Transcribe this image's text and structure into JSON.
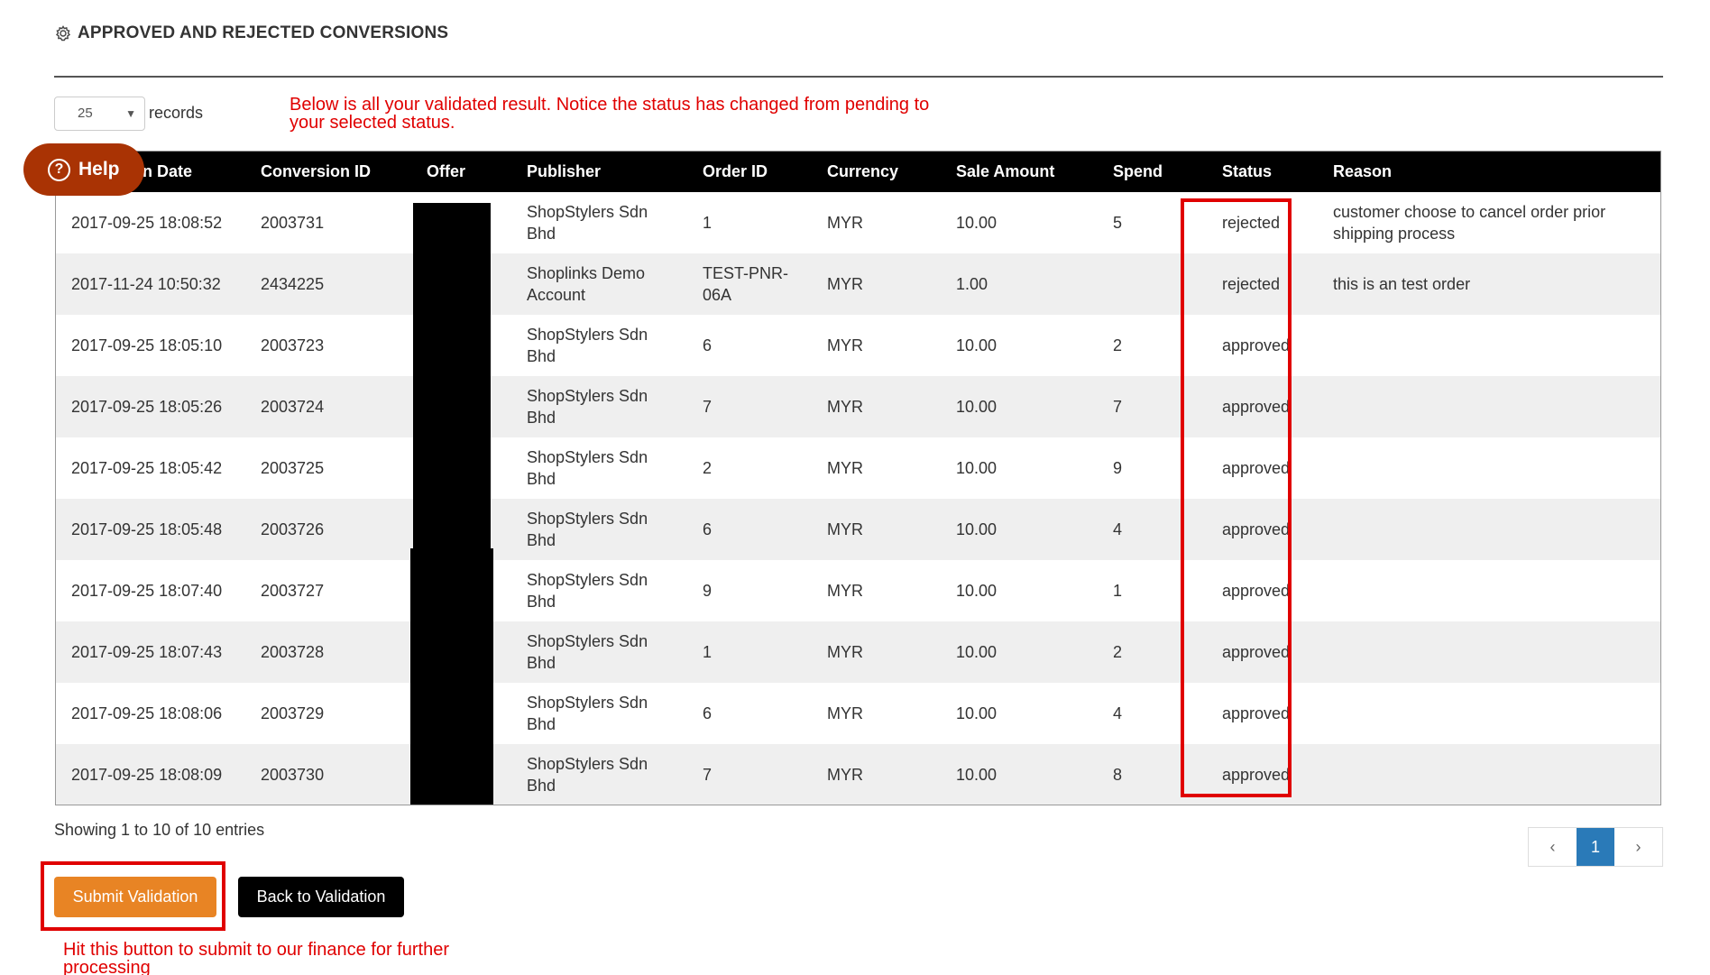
{
  "section": {
    "title": "APPROVED AND REJECTED CONVERSIONS",
    "icon": "gear-icon"
  },
  "records": {
    "selected": "25",
    "label": "records"
  },
  "annotations": {
    "top": "Below is all your validated result. Notice the status has changed from pending to your selected status.",
    "bottom": "Hit this button to submit to our finance for further processing"
  },
  "help": {
    "label": "Help",
    "glyph": "?"
  },
  "table": {
    "columns": {
      "date": "n Date",
      "conversion_id": "Conversion ID",
      "offer": "Offer",
      "publisher": "Publisher",
      "order_id": "Order ID",
      "currency": "Currency",
      "sale_amount": "Sale Amount",
      "spend": "Spend",
      "status": "Status",
      "reason": "Reason"
    },
    "rows": [
      {
        "date": "2017-09-25 18:08:52",
        "conversion_id": "2003731",
        "publisher": "ShopStylers Sdn Bhd",
        "order_id": "1",
        "currency": "MYR",
        "sale_amount": "10.00",
        "spend": "5",
        "status": "rejected",
        "reason": "customer choose to cancel order prior shipping process"
      },
      {
        "date": "2017-11-24 10:50:32",
        "conversion_id": "2434225",
        "publisher": "Shoplinks Demo Account",
        "order_id": "TEST-PNR-06A",
        "currency": "MYR",
        "sale_amount": "1.00",
        "spend": "",
        "status": "rejected",
        "reason": "this is an test order"
      },
      {
        "date": "2017-09-25 18:05:10",
        "conversion_id": "2003723",
        "publisher": "ShopStylers Sdn Bhd",
        "order_id": "6",
        "currency": "MYR",
        "sale_amount": "10.00",
        "spend": "2",
        "status": "approved",
        "reason": ""
      },
      {
        "date": "2017-09-25 18:05:26",
        "conversion_id": "2003724",
        "publisher": "ShopStylers Sdn Bhd",
        "order_id": "7",
        "currency": "MYR",
        "sale_amount": "10.00",
        "spend": "7",
        "status": "approved",
        "reason": ""
      },
      {
        "date": "2017-09-25 18:05:42",
        "conversion_id": "2003725",
        "publisher": "ShopStylers Sdn Bhd",
        "order_id": "2",
        "currency": "MYR",
        "sale_amount": "10.00",
        "spend": "9",
        "status": "approved",
        "reason": ""
      },
      {
        "date": "2017-09-25 18:05:48",
        "conversion_id": "2003726",
        "publisher": "ShopStylers Sdn Bhd",
        "order_id": "6",
        "currency": "MYR",
        "sale_amount": "10.00",
        "spend": "4",
        "status": "approved",
        "reason": ""
      },
      {
        "date": "2017-09-25 18:07:40",
        "conversion_id": "2003727",
        "publisher": "ShopStylers Sdn Bhd",
        "order_id": "9",
        "currency": "MYR",
        "sale_amount": "10.00",
        "spend": "1",
        "status": "approved",
        "reason": ""
      },
      {
        "date": "2017-09-25 18:07:43",
        "conversion_id": "2003728",
        "publisher": "ShopStylers Sdn Bhd",
        "order_id": "1",
        "currency": "MYR",
        "sale_amount": "10.00",
        "spend": "2",
        "status": "approved",
        "reason": ""
      },
      {
        "date": "2017-09-25 18:08:06",
        "conversion_id": "2003729",
        "publisher": "ShopStylers Sdn Bhd",
        "order_id": "6",
        "currency": "MYR",
        "sale_amount": "10.00",
        "spend": "4",
        "status": "approved",
        "reason": ""
      },
      {
        "date": "2017-09-25 18:08:09",
        "conversion_id": "2003730",
        "publisher": "ShopStylers Sdn Bhd",
        "order_id": "7",
        "currency": "MYR",
        "sale_amount": "10.00",
        "spend": "8",
        "status": "approved",
        "reason": ""
      }
    ]
  },
  "info": "Showing 1 to 10 of 10 entries",
  "pagination": {
    "prev": "‹",
    "current": "1",
    "next": "›"
  },
  "buttons": {
    "submit": "Submit Validation",
    "back": "Back to Validation"
  },
  "colors": {
    "accent_orange": "#e88424",
    "help_brown": "#a93304",
    "annotation_red": "#e00000",
    "page_active_blue": "#2a7ab8"
  }
}
